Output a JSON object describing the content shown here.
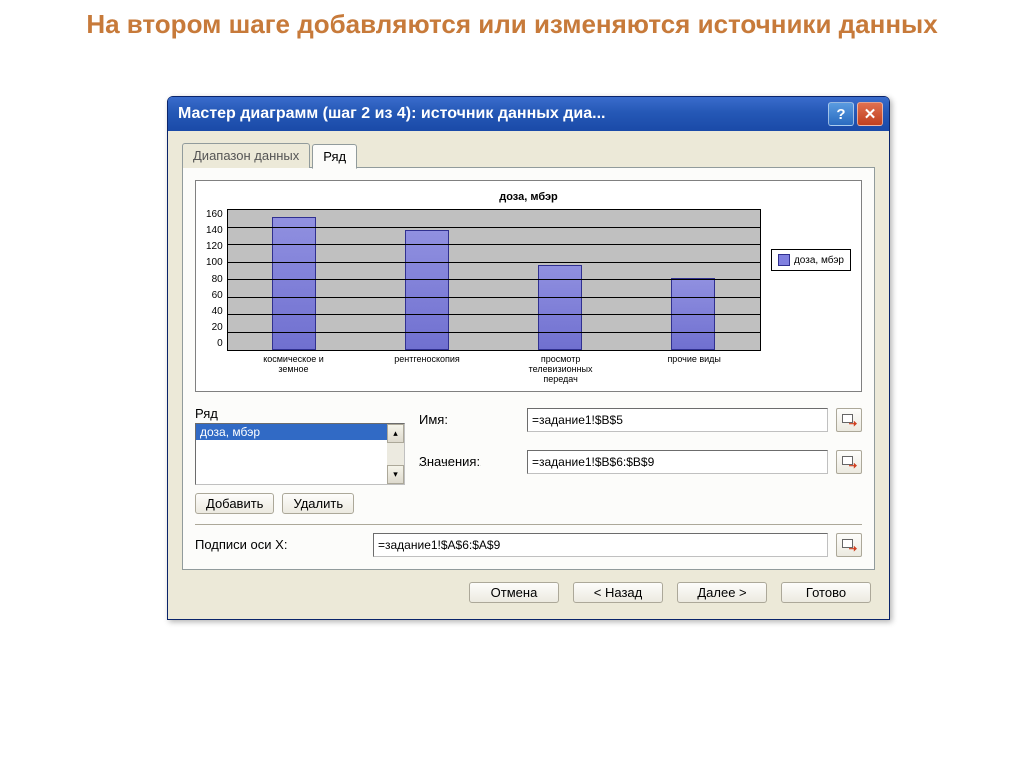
{
  "page_heading": "На втором шаге добавляются или изменяются источники данных",
  "titlebar": "Мастер диаграмм (шаг 2 из 4): источник данных диа...",
  "tabs": {
    "data_range": "Диапазон данных",
    "series": "Ряд"
  },
  "series_section": {
    "label": "Ряд",
    "selected_item": "доза, мбэр",
    "add": "Добавить",
    "remove": "Удалить"
  },
  "fields": {
    "name_label": "Имя:",
    "name_value": "=задание1!$B$5",
    "values_label": "Значения:",
    "values_value": "=задание1!$B$6:$B$9",
    "xlabels_label": "Подписи оси X:",
    "xlabels_value": "=задание1!$A$6:$A$9"
  },
  "footer": {
    "cancel": "Отмена",
    "back": "< Назад",
    "next": "Далее >",
    "finish": "Готово"
  },
  "chart_data": {
    "type": "bar",
    "title": "доза, мбэр",
    "legend": "доза, мбэр",
    "ylim": [
      0,
      160
    ],
    "yticks": [
      0,
      20,
      40,
      60,
      80,
      100,
      120,
      140,
      160
    ],
    "categories": [
      "космическое и земное",
      "рентгеноскопия",
      "просмотр телевизионных передач",
      "прочие виды"
    ],
    "values": [
      150,
      135,
      95,
      80
    ]
  }
}
